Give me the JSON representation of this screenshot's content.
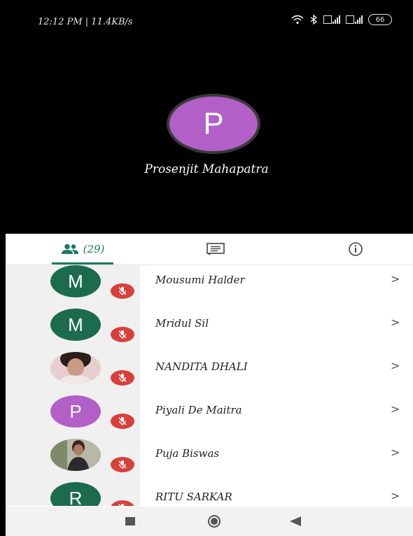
{
  "status_bar": {
    "left_text": "12:12 PM | 11.4KB/s",
    "battery": "66"
  },
  "speaker": {
    "initial": "P",
    "name": "Prosenjit Mahapatra",
    "avatar_color": "#b25fc7"
  },
  "tabs": {
    "participants_count": "(29)",
    "accent_color": "#1a7a64"
  },
  "participants": [
    {
      "name": "Mousumi Halder",
      "initial": "M",
      "avatar_color": "#1c6b4d",
      "photo": false
    },
    {
      "name": "Mridul Sil",
      "initial": "M",
      "avatar_color": "#1c6b4d",
      "photo": false
    },
    {
      "name": "NANDITA DHALI",
      "initial": "",
      "avatar_color": "#d9b3a8",
      "photo": true
    },
    {
      "name": "Piyali De Maitra",
      "initial": "P",
      "avatar_color": "#b25fc7",
      "photo": false
    },
    {
      "name": "Puja Biswas",
      "initial": "",
      "avatar_color": "#9aa08e",
      "photo": true
    },
    {
      "name": "RITU SARKAR",
      "initial": "R",
      "avatar_color": "#1c6b4d",
      "photo": false
    }
  ],
  "chevron": ">",
  "mute_color": "#d8403b"
}
